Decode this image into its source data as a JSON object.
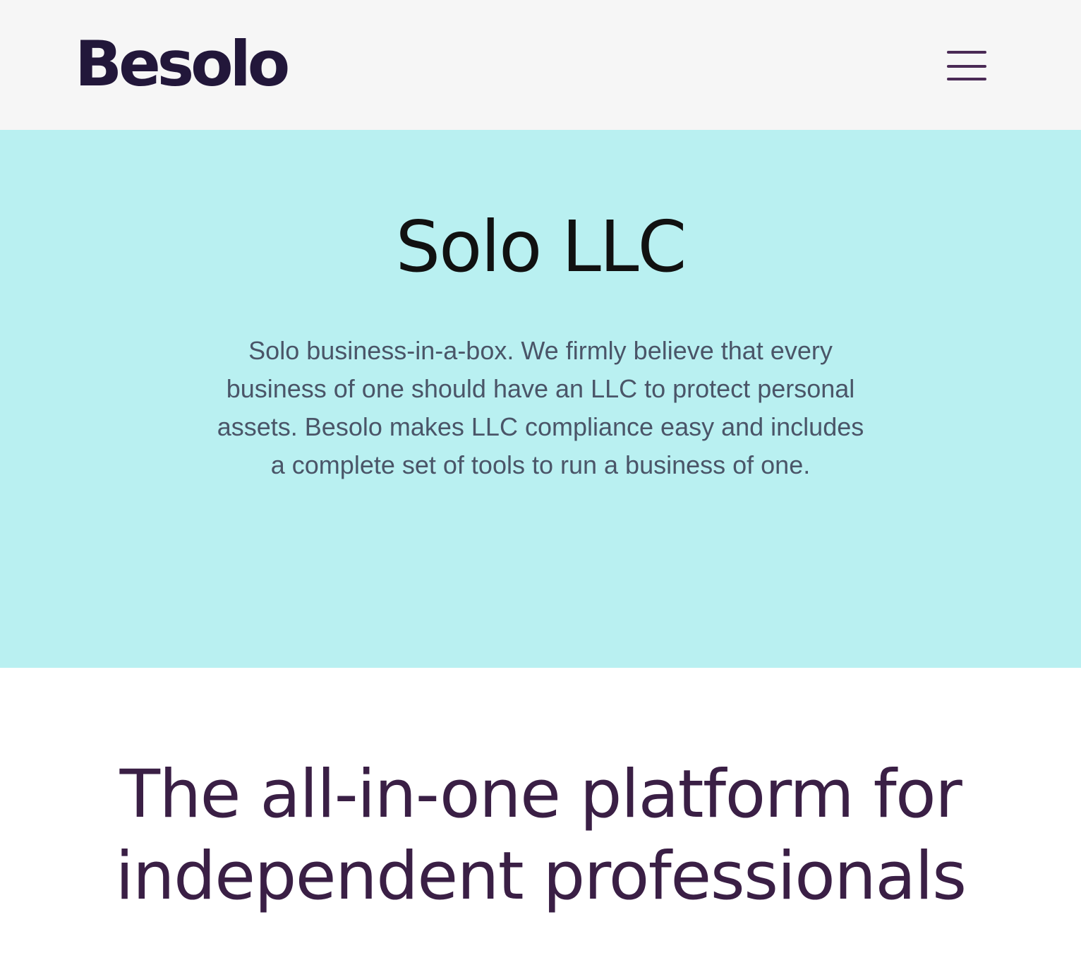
{
  "header": {
    "logo_text": "Besolo",
    "menu_icon": "hamburger-menu-icon"
  },
  "hero": {
    "title": "Solo LLC",
    "description": "Solo business-in-a-box. We firmly believe that every business of one should have an LLC to protect personal assets. Besolo makes LLC compliance easy and includes a complete set of tools to run a business of one."
  },
  "section": {
    "heading": "The all-in-one platform for independent professionals"
  },
  "colors": {
    "header_bg": "#f6f6f6",
    "hero_bg": "#b9f0f1",
    "logo": "#22173a",
    "menu_icon": "#4a2a55",
    "hero_title": "#111111",
    "hero_text": "#4a5568",
    "section_heading": "#3a1f45"
  }
}
